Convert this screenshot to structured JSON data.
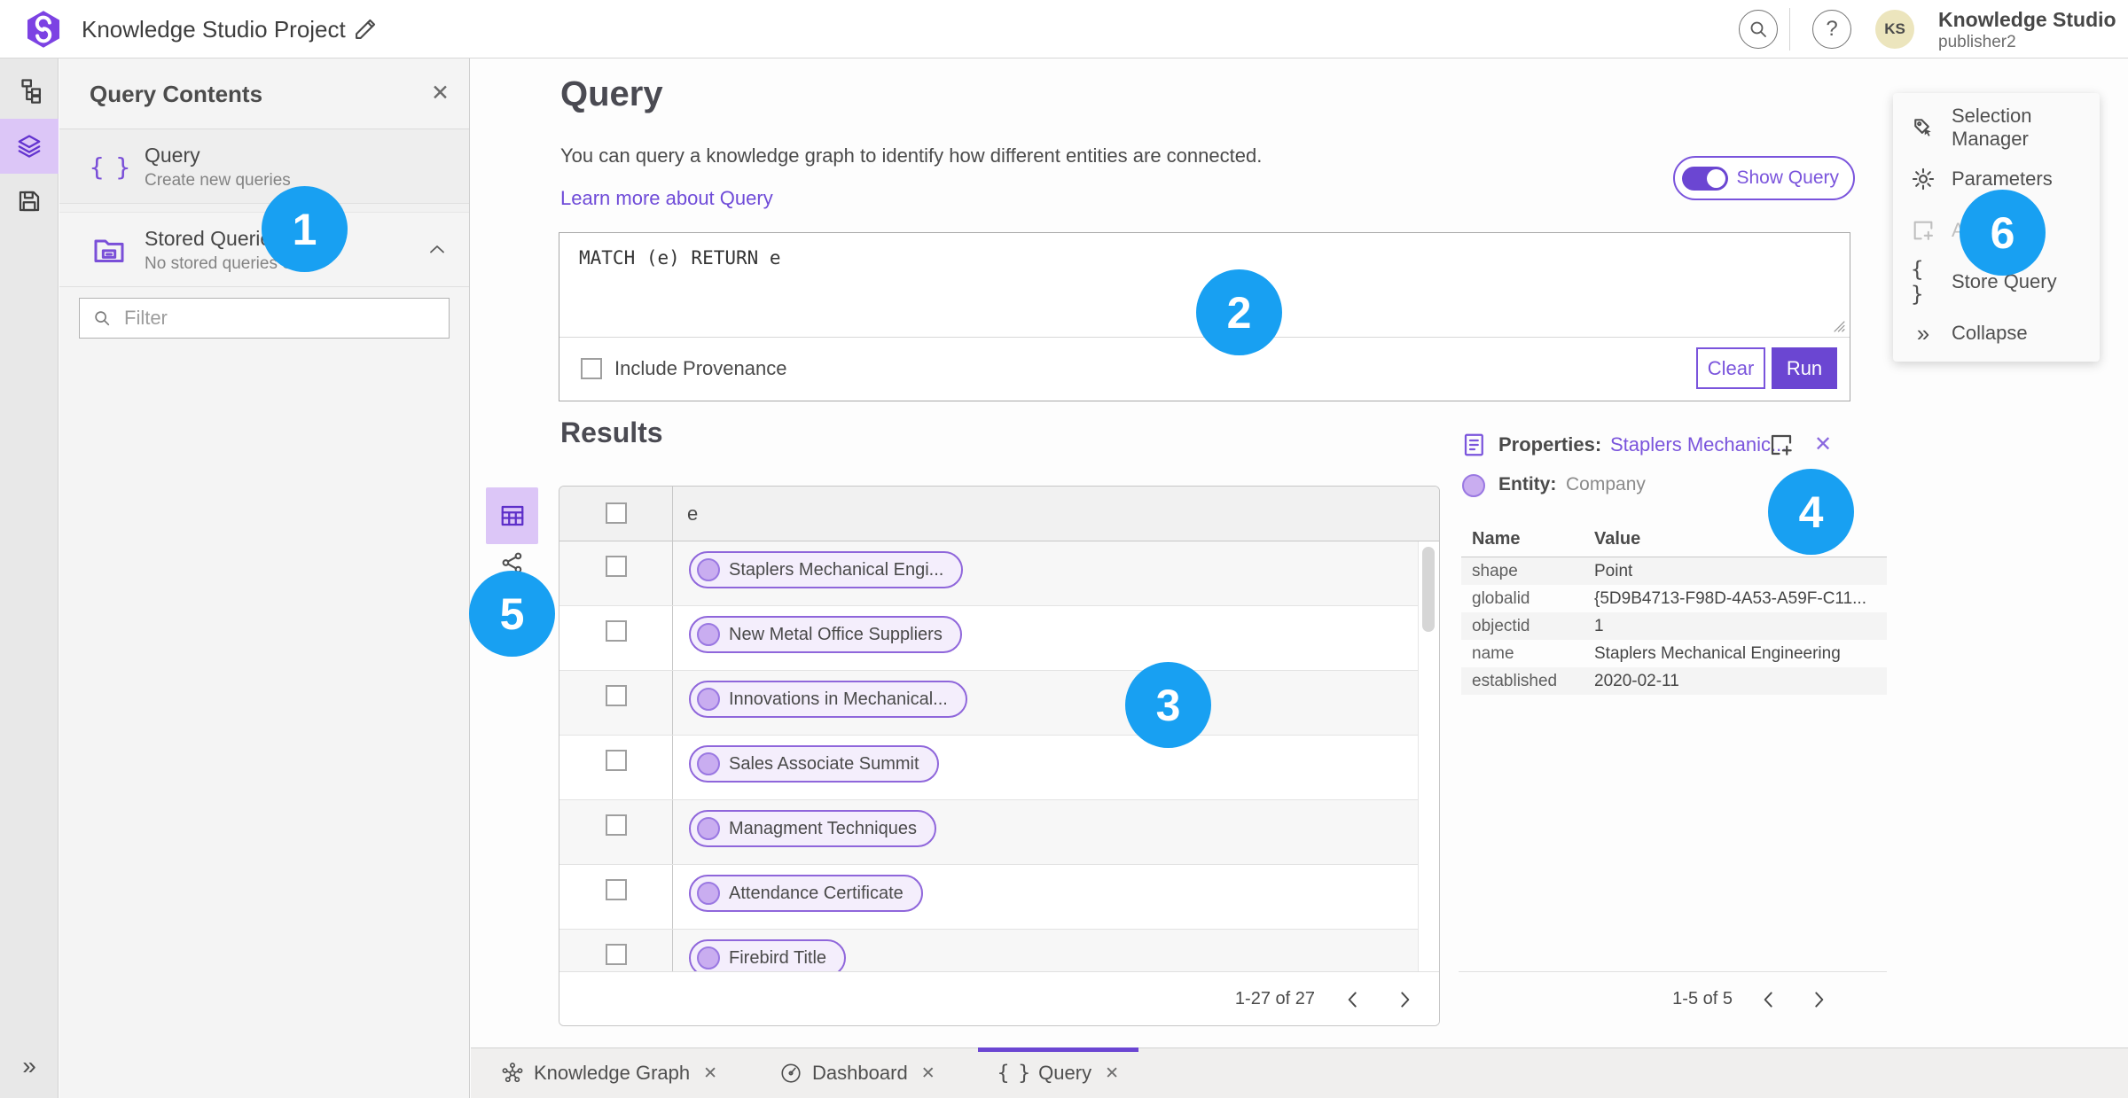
{
  "header": {
    "app_title": "Knowledge Studio Project",
    "user_name": "Knowledge Studio",
    "user_role": "publisher2",
    "avatar_initials": "KS",
    "help_glyph": "?"
  },
  "icons": {
    "close": "✕",
    "braces": "{ }",
    "double_chevron_right": "»"
  },
  "left_panel": {
    "title": "Query Contents",
    "query_item": {
      "title": "Query",
      "subtitle": "Create new queries"
    },
    "stored_item": {
      "title": "Stored Queries",
      "subtitle": "No stored queries exist"
    },
    "filter_placeholder": "Filter"
  },
  "query_section": {
    "title": "Query",
    "description": "You can query a knowledge graph to identify how different entities are connected.",
    "learn_more_link": "Learn more about Query",
    "show_query_label": "Show Query",
    "query_text": "MATCH (e) RETURN e",
    "include_provenance_label": "Include Provenance",
    "clear_button": "Clear",
    "run_button": "Run"
  },
  "results": {
    "title": "Results",
    "column_header": "e",
    "rows": [
      "Staplers Mechanical Engi...",
      "New Metal Office Suppliers",
      "Innovations in Mechanical...",
      "Sales Associate Summit",
      "Managment Techniques",
      "Attendance Certificate",
      "Firebird Title"
    ],
    "pagination": "1-27 of 27"
  },
  "properties_panel": {
    "title_label": "Properties:",
    "title_link": "Staplers Mechanic...",
    "entity_label": "Entity:",
    "entity_value": "Company",
    "name_header": "Name",
    "value_header": "Value",
    "rows": [
      {
        "name": "shape",
        "value": "Point"
      },
      {
        "name": "globalid",
        "value": "{5D9B4713-F98D-4A53-A59F-C11..."
      },
      {
        "name": "objectid",
        "value": "1"
      },
      {
        "name": "name",
        "value": "Staplers Mechanical Engineering"
      },
      {
        "name": "established",
        "value": "2020-02-11"
      }
    ],
    "pagination": "1-5 of 5"
  },
  "right_menu": {
    "items": [
      {
        "label": "Selection Manager"
      },
      {
        "label": "Parameters"
      },
      {
        "label": "Add"
      },
      {
        "label": "Store Query"
      },
      {
        "label": "Collapse"
      }
    ]
  },
  "bottom_tabs": [
    {
      "label": "Knowledge Graph"
    },
    {
      "label": "Dashboard"
    },
    {
      "label": "Query"
    }
  ],
  "annotations": {
    "badges": [
      "1",
      "2",
      "3",
      "4",
      "5",
      "6"
    ]
  },
  "colors": {
    "accent_purple": "#6b46d2",
    "link_purple": "#7a54dc",
    "badge_blue": "#18a0f2",
    "rail_selected_bg": "#dcc6f7",
    "pill_border": "#8f66db",
    "pill_bg": "#f4eefc",
    "avatar_bg": "#ece5bd"
  }
}
